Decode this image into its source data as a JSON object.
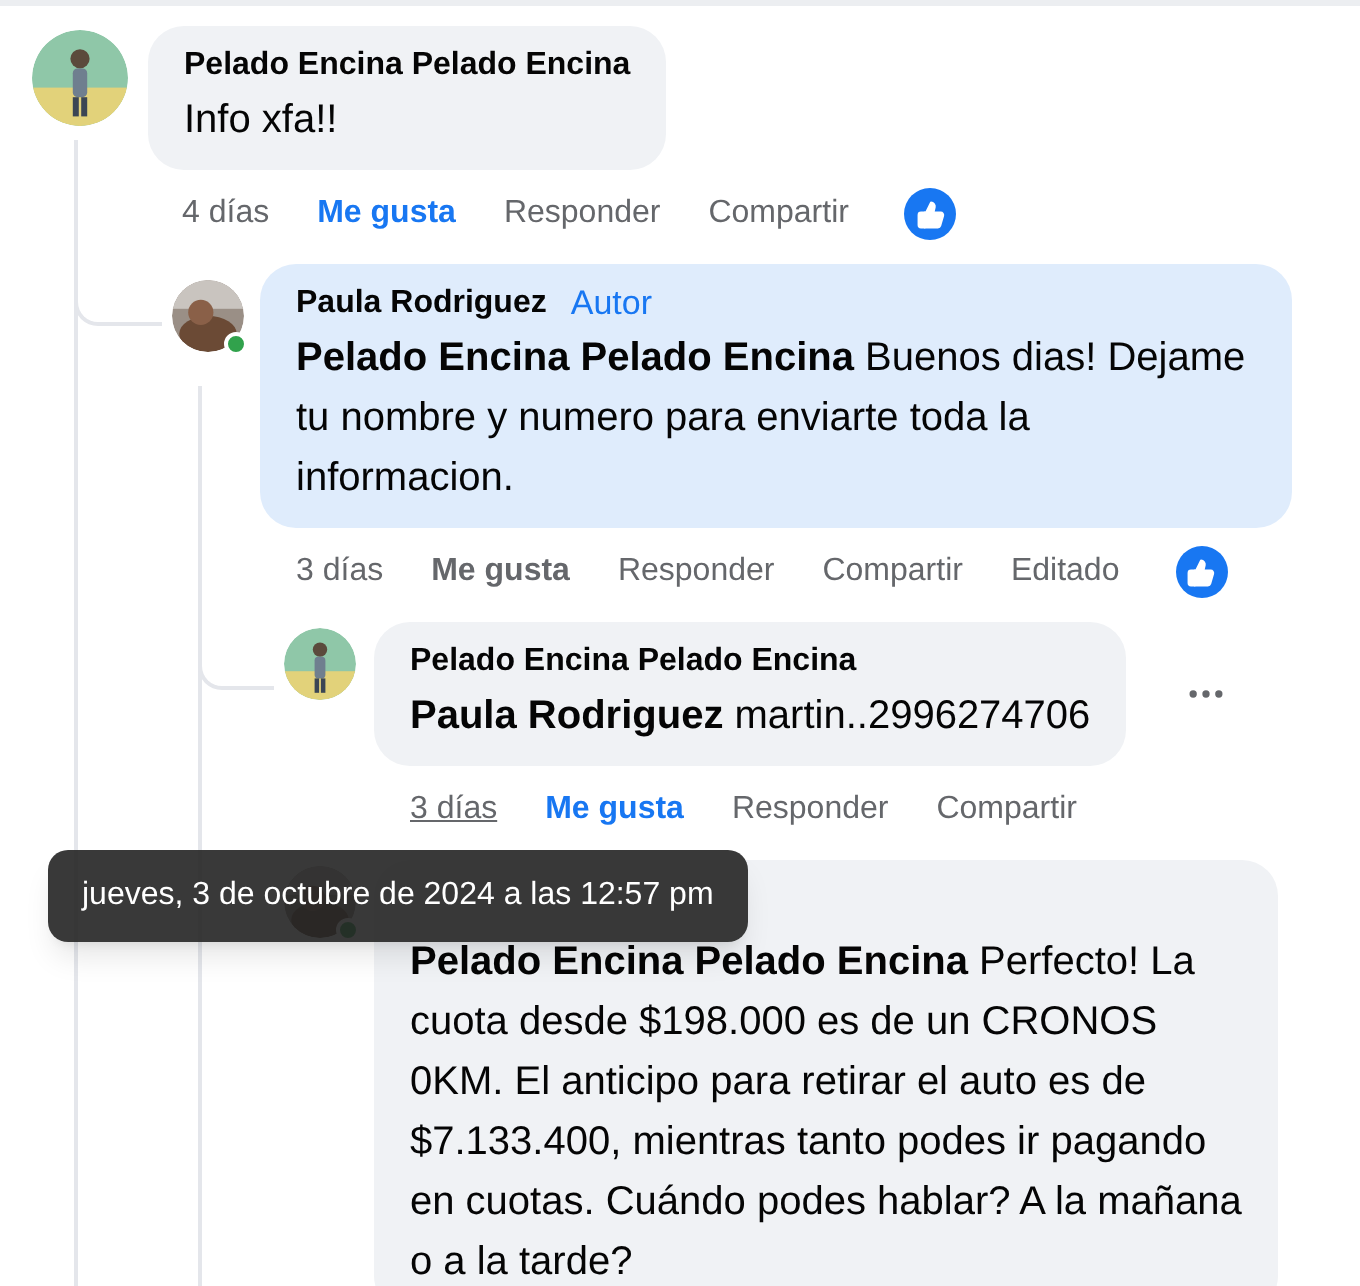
{
  "comments": [
    {
      "author": "Pelado Encina Pelado Encina",
      "text": "Info xfa!!",
      "avatar": {
        "kind": "figure"
      },
      "online": false,
      "highlighted": false,
      "time": "4 días",
      "time_hovered": false,
      "like_label": "Me gusta",
      "liked": true,
      "actions": [
        "Responder",
        "Compartir"
      ],
      "has_like_reaction": true,
      "menu": false,
      "children": [
        {
          "author": "Paula Rodriguez",
          "badge": "Autor",
          "mention": "Pelado Encina Pelado Encina",
          "text": "Buenos dias! Dejame tu nombre y numero para enviarte toda la informacion.",
          "avatar": {
            "kind": "photo"
          },
          "online": true,
          "highlighted": true,
          "time": "3 días",
          "time_hovered": false,
          "like_label": "Me gusta",
          "liked": false,
          "actions": [
            "Responder",
            "Compartir",
            "Editado"
          ],
          "has_like_reaction": true,
          "menu": false,
          "children": [
            {
              "author": "Pelado Encina Pelado Encina",
              "mention": "Paula Rodriguez",
              "text": "martin..2996274706",
              "avatar": {
                "kind": "figure"
              },
              "online": false,
              "highlighted": false,
              "time": "3 días",
              "time_hovered": true,
              "like_label": "Me gusta",
              "liked": true,
              "actions": [
                "Responder",
                "Compartir"
              ],
              "has_like_reaction": false,
              "menu": true
            },
            {
              "mention": "Pelado Encina Pelado Encina",
              "text": "Perfecto! La cuota desde $198.000 es de un CRONOS 0KM. El anticipo para retirar el auto es de $7.133.400, mientras tanto podes ir pagando en cuotas. Cuándo podes hablar? A la mañana o a la tarde?",
              "avatar": {
                "kind": "photo"
              },
              "online": true,
              "highlighted": false,
              "has_like_reaction": false,
              "menu": false
            }
          ]
        }
      ]
    }
  ],
  "tooltip": {
    "text": "jueves, 3 de octubre de 2024 a las 12:57 pm"
  }
}
